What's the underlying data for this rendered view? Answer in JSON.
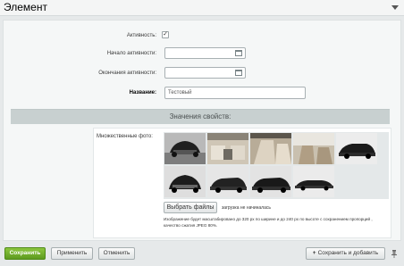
{
  "header": {
    "title": "Элемент"
  },
  "form": {
    "active_label": "Активность:",
    "active_checked": true,
    "active_check_glyph": "✓",
    "start_label": "Начало активности:",
    "start_value": "",
    "end_label": "Окончания активности:",
    "end_value": "",
    "name_label": "Название:",
    "name_value": "Тестовый"
  },
  "section": {
    "title": "Значения свойств:"
  },
  "photos": {
    "label": "Множественные фото:",
    "select_button": "Выбрать файлы",
    "upload_status": "загрузка не начиналась",
    "note": "Изображение будет масштабировано до 320 px по ширине и до 240 px по высоте с сохранением пропорций , качество сжатия JPEG 80%."
  },
  "footer": {
    "save": "Сохранить",
    "apply": "Применить",
    "cancel": "Отменить",
    "save_add": "Сохранить и добавить",
    "plus_glyph": "+"
  },
  "icons": [
    "collapse-arrow-icon",
    "calendar-icon",
    "plus-icon",
    "pin-icon"
  ],
  "colors": {
    "background": "#e6e9ea",
    "section_bar": "#c8d0d0",
    "primary_button": "#6fae2a"
  }
}
